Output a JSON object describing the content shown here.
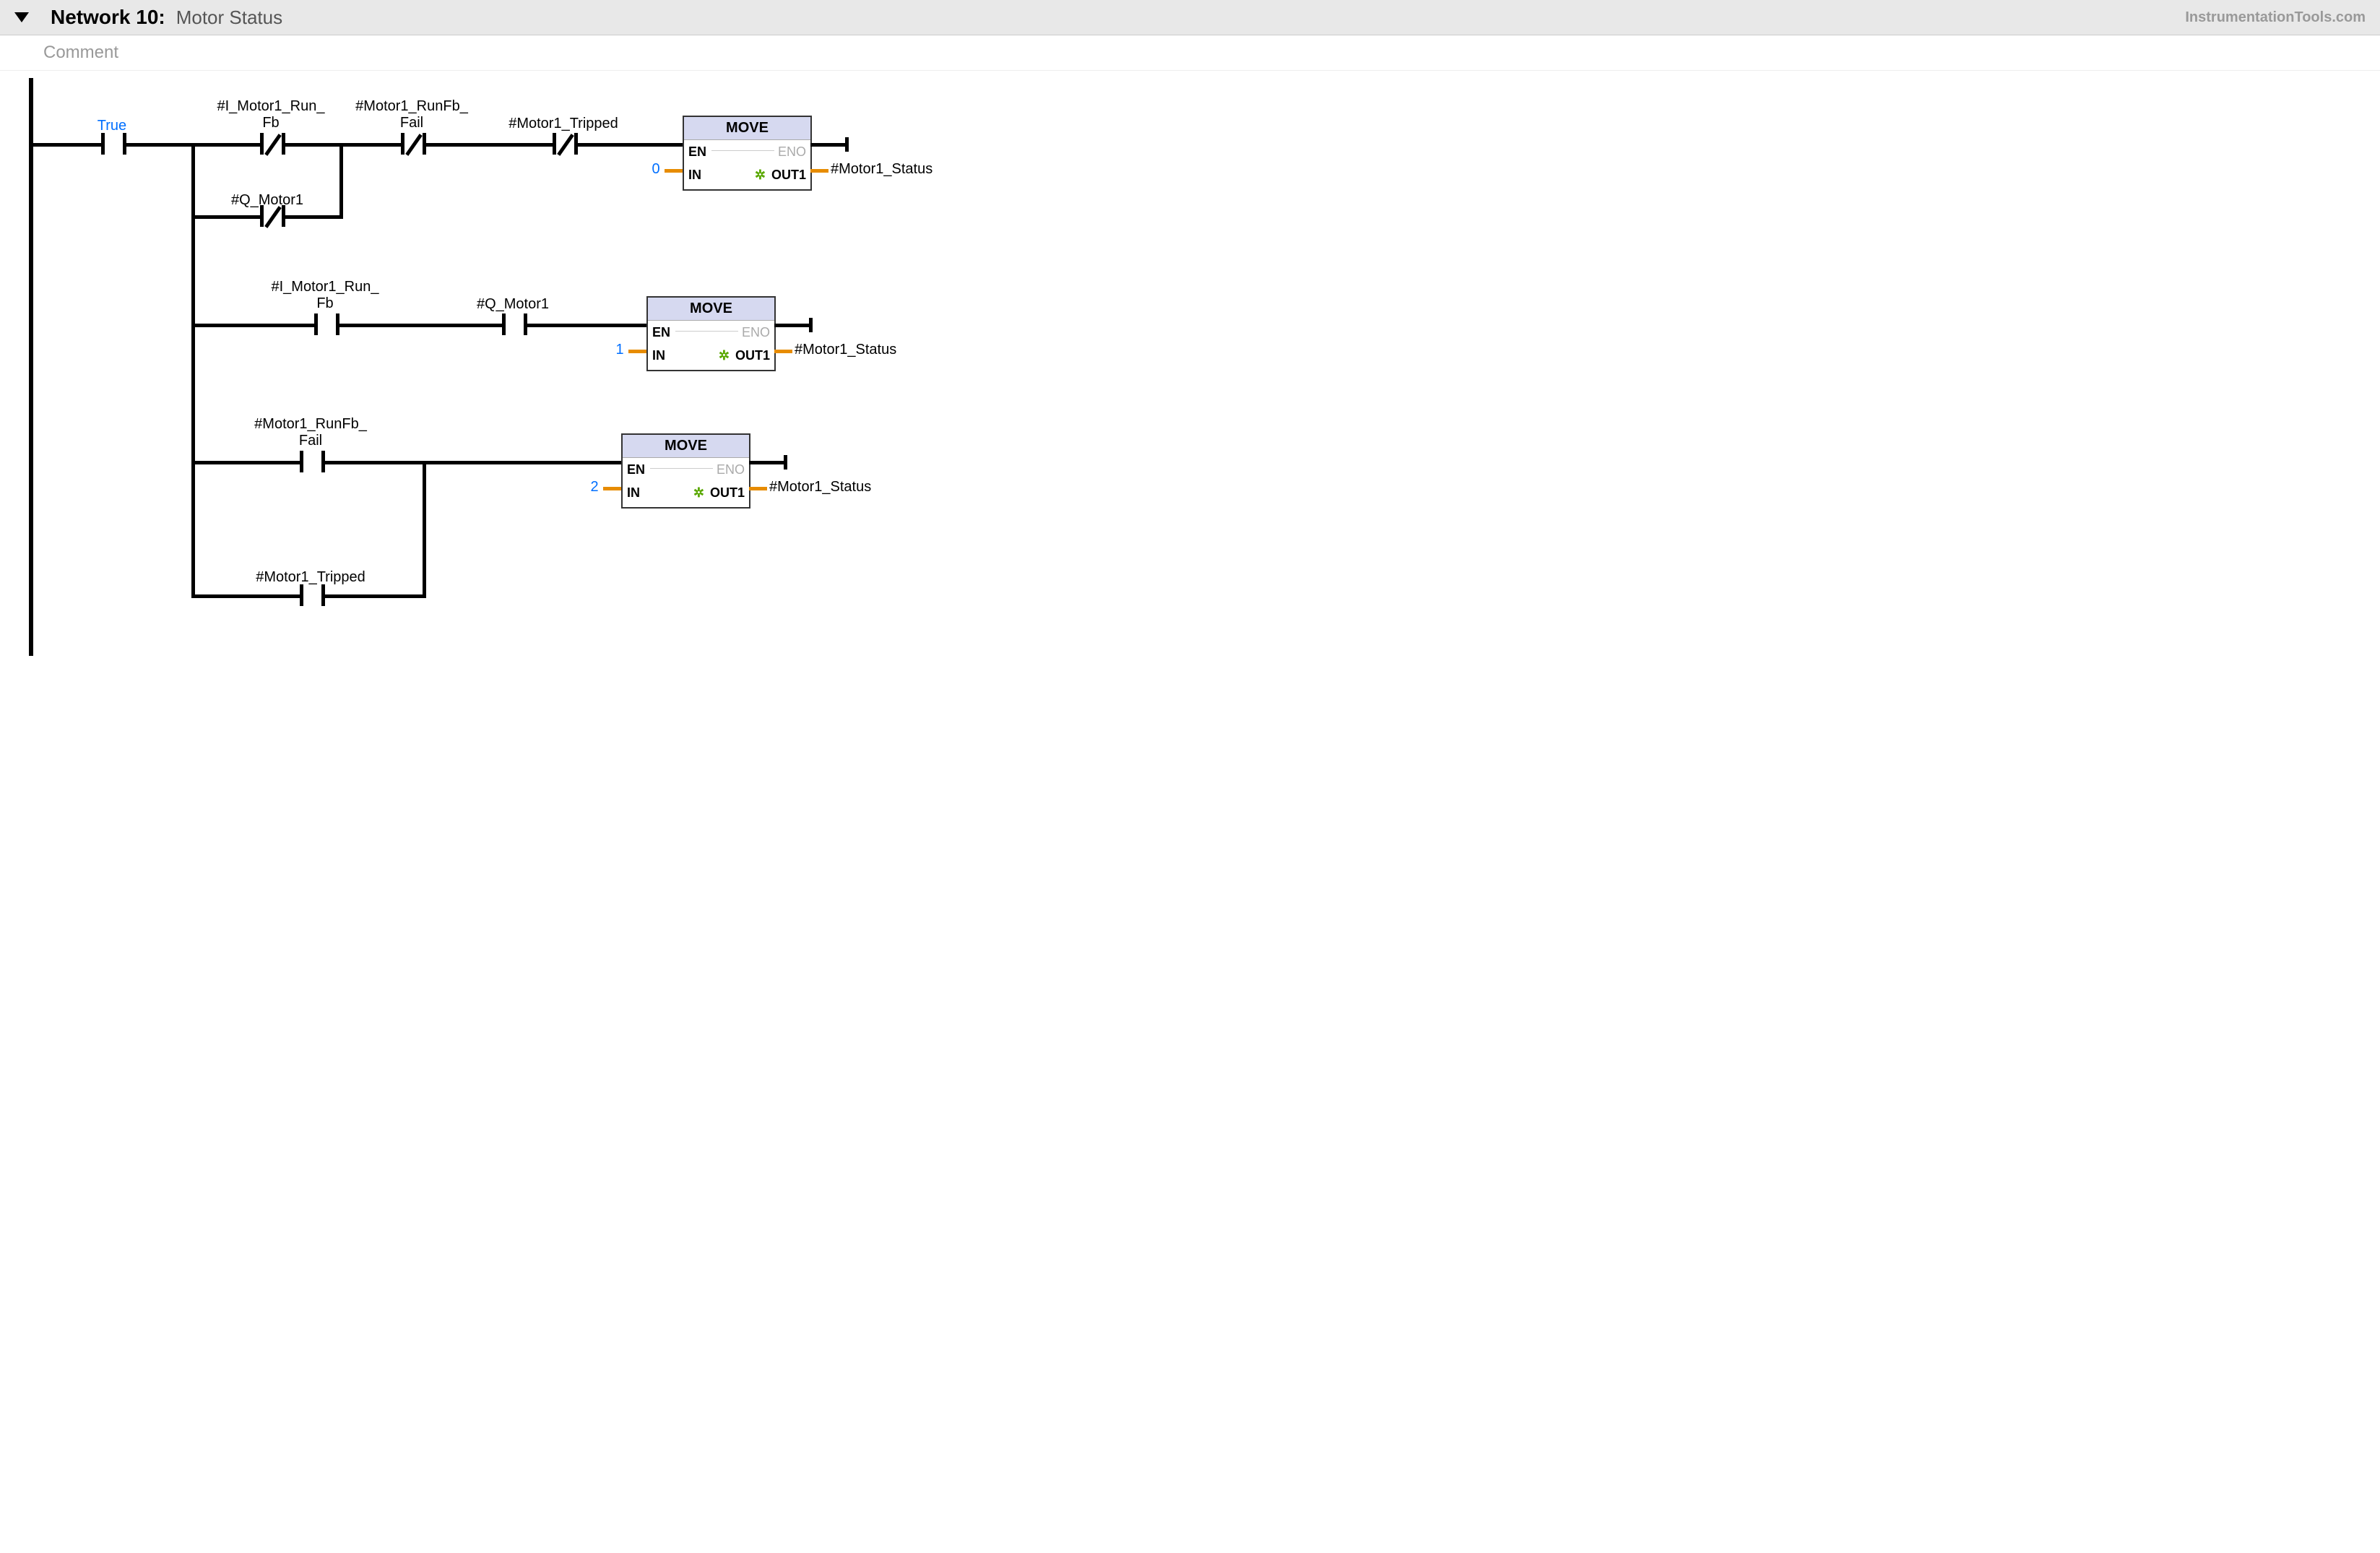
{
  "header": {
    "network_label": "Network 10:",
    "network_name": "Motor Status",
    "watermark": "InstrumentationTools.com"
  },
  "comment": "Comment",
  "tags": {
    "true": "True",
    "i_motor1_run_fb": "#I_Motor1_Run_\nFb",
    "motor1_runfb_fail": "#Motor1_RunFb_\nFail",
    "motor1_tripped": "#Motor1_Tripped",
    "q_motor1": "#Q_Motor1",
    "motor1_status": "#Motor1_Status"
  },
  "moves": {
    "title": "MOVE",
    "en": "EN",
    "eno": "ENO",
    "in": "IN",
    "out1": "OUT1"
  },
  "values": {
    "zero": "0",
    "one": "1",
    "two": "2"
  }
}
